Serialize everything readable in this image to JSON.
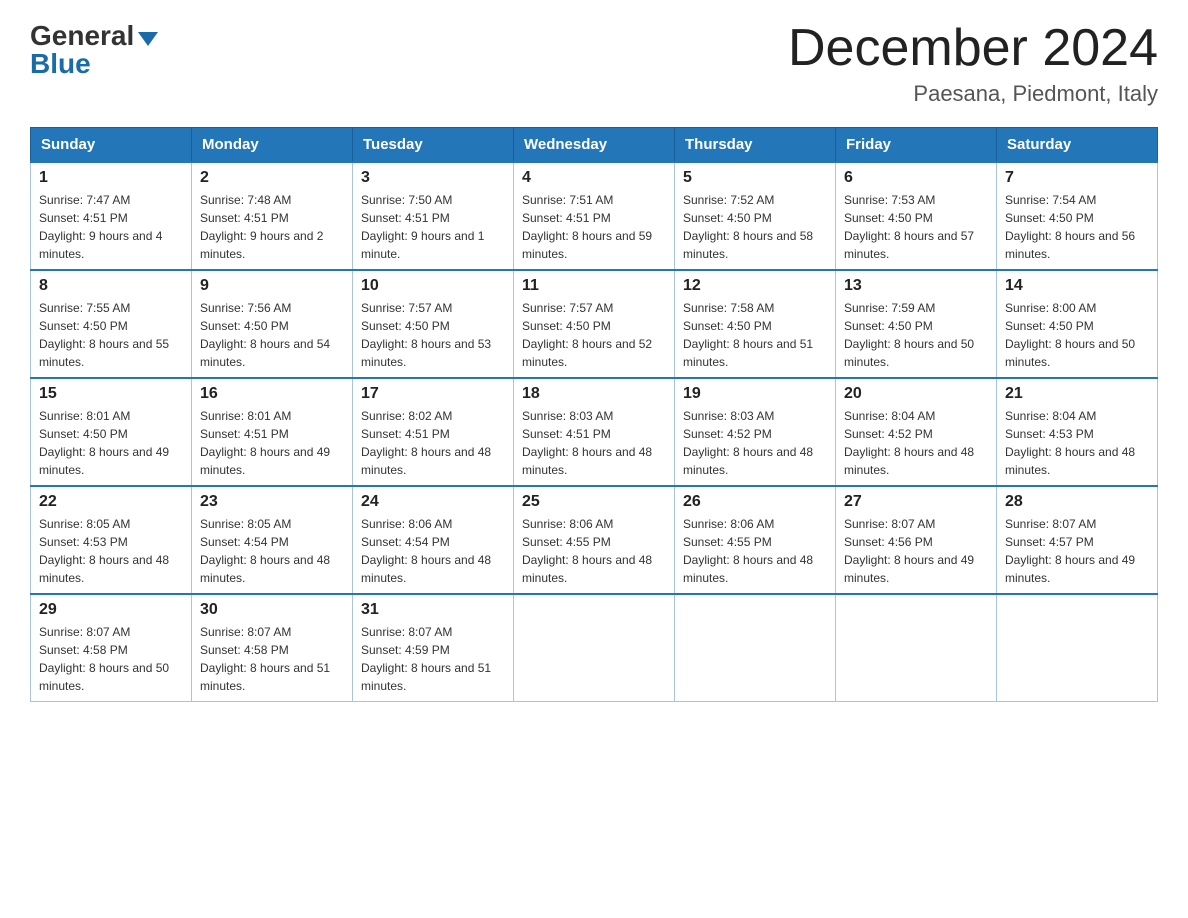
{
  "header": {
    "logo_general": "General",
    "logo_blue": "Blue",
    "month_title": "December 2024",
    "location": "Paesana, Piedmont, Italy"
  },
  "calendar": {
    "days_of_week": [
      "Sunday",
      "Monday",
      "Tuesday",
      "Wednesday",
      "Thursday",
      "Friday",
      "Saturday"
    ],
    "weeks": [
      [
        {
          "day": "1",
          "sunrise": "7:47 AM",
          "sunset": "4:51 PM",
          "daylight": "9 hours and 4 minutes."
        },
        {
          "day": "2",
          "sunrise": "7:48 AM",
          "sunset": "4:51 PM",
          "daylight": "9 hours and 2 minutes."
        },
        {
          "day": "3",
          "sunrise": "7:50 AM",
          "sunset": "4:51 PM",
          "daylight": "9 hours and 1 minute."
        },
        {
          "day": "4",
          "sunrise": "7:51 AM",
          "sunset": "4:51 PM",
          "daylight": "8 hours and 59 minutes."
        },
        {
          "day": "5",
          "sunrise": "7:52 AM",
          "sunset": "4:50 PM",
          "daylight": "8 hours and 58 minutes."
        },
        {
          "day": "6",
          "sunrise": "7:53 AM",
          "sunset": "4:50 PM",
          "daylight": "8 hours and 57 minutes."
        },
        {
          "day": "7",
          "sunrise": "7:54 AM",
          "sunset": "4:50 PM",
          "daylight": "8 hours and 56 minutes."
        }
      ],
      [
        {
          "day": "8",
          "sunrise": "7:55 AM",
          "sunset": "4:50 PM",
          "daylight": "8 hours and 55 minutes."
        },
        {
          "day": "9",
          "sunrise": "7:56 AM",
          "sunset": "4:50 PM",
          "daylight": "8 hours and 54 minutes."
        },
        {
          "day": "10",
          "sunrise": "7:57 AM",
          "sunset": "4:50 PM",
          "daylight": "8 hours and 53 minutes."
        },
        {
          "day": "11",
          "sunrise": "7:57 AM",
          "sunset": "4:50 PM",
          "daylight": "8 hours and 52 minutes."
        },
        {
          "day": "12",
          "sunrise": "7:58 AM",
          "sunset": "4:50 PM",
          "daylight": "8 hours and 51 minutes."
        },
        {
          "day": "13",
          "sunrise": "7:59 AM",
          "sunset": "4:50 PM",
          "daylight": "8 hours and 50 minutes."
        },
        {
          "day": "14",
          "sunrise": "8:00 AM",
          "sunset": "4:50 PM",
          "daylight": "8 hours and 50 minutes."
        }
      ],
      [
        {
          "day": "15",
          "sunrise": "8:01 AM",
          "sunset": "4:50 PM",
          "daylight": "8 hours and 49 minutes."
        },
        {
          "day": "16",
          "sunrise": "8:01 AM",
          "sunset": "4:51 PM",
          "daylight": "8 hours and 49 minutes."
        },
        {
          "day": "17",
          "sunrise": "8:02 AM",
          "sunset": "4:51 PM",
          "daylight": "8 hours and 48 minutes."
        },
        {
          "day": "18",
          "sunrise": "8:03 AM",
          "sunset": "4:51 PM",
          "daylight": "8 hours and 48 minutes."
        },
        {
          "day": "19",
          "sunrise": "8:03 AM",
          "sunset": "4:52 PM",
          "daylight": "8 hours and 48 minutes."
        },
        {
          "day": "20",
          "sunrise": "8:04 AM",
          "sunset": "4:52 PM",
          "daylight": "8 hours and 48 minutes."
        },
        {
          "day": "21",
          "sunrise": "8:04 AM",
          "sunset": "4:53 PM",
          "daylight": "8 hours and 48 minutes."
        }
      ],
      [
        {
          "day": "22",
          "sunrise": "8:05 AM",
          "sunset": "4:53 PM",
          "daylight": "8 hours and 48 minutes."
        },
        {
          "day": "23",
          "sunrise": "8:05 AM",
          "sunset": "4:54 PM",
          "daylight": "8 hours and 48 minutes."
        },
        {
          "day": "24",
          "sunrise": "8:06 AM",
          "sunset": "4:54 PM",
          "daylight": "8 hours and 48 minutes."
        },
        {
          "day": "25",
          "sunrise": "8:06 AM",
          "sunset": "4:55 PM",
          "daylight": "8 hours and 48 minutes."
        },
        {
          "day": "26",
          "sunrise": "8:06 AM",
          "sunset": "4:55 PM",
          "daylight": "8 hours and 48 minutes."
        },
        {
          "day": "27",
          "sunrise": "8:07 AM",
          "sunset": "4:56 PM",
          "daylight": "8 hours and 49 minutes."
        },
        {
          "day": "28",
          "sunrise": "8:07 AM",
          "sunset": "4:57 PM",
          "daylight": "8 hours and 49 minutes."
        }
      ],
      [
        {
          "day": "29",
          "sunrise": "8:07 AM",
          "sunset": "4:58 PM",
          "daylight": "8 hours and 50 minutes."
        },
        {
          "day": "30",
          "sunrise": "8:07 AM",
          "sunset": "4:58 PM",
          "daylight": "8 hours and 51 minutes."
        },
        {
          "day": "31",
          "sunrise": "8:07 AM",
          "sunset": "4:59 PM",
          "daylight": "8 hours and 51 minutes."
        },
        null,
        null,
        null,
        null
      ]
    ]
  }
}
